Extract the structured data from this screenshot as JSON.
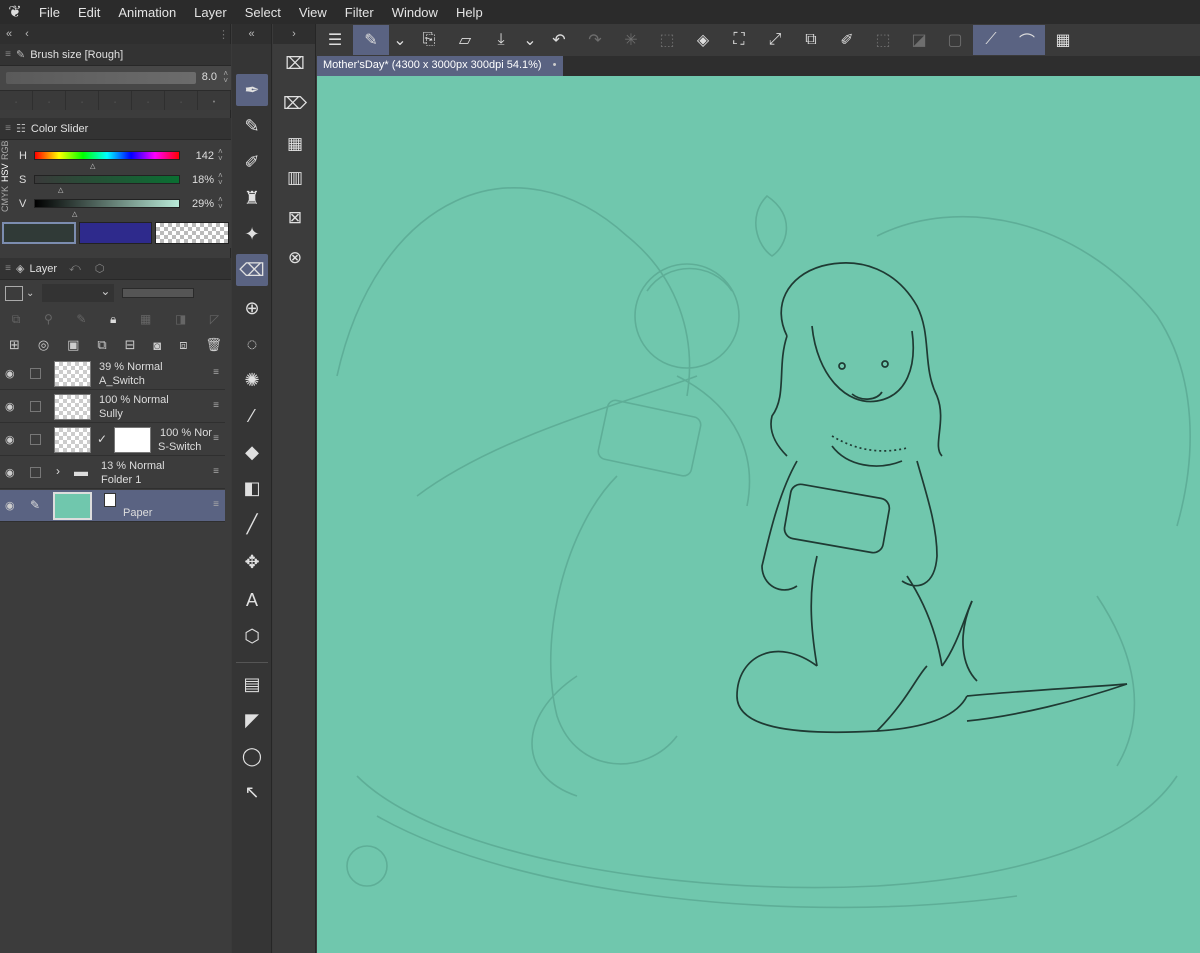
{
  "menu": [
    "File",
    "Edit",
    "Animation",
    "Layer",
    "Select",
    "View",
    "Filter",
    "Window",
    "Help"
  ],
  "brush": {
    "title": "Brush size [Rough]",
    "value": "8.0"
  },
  "color_slider": {
    "title": "Color Slider",
    "modes": [
      "RGB",
      "HSV",
      "CMYK"
    ],
    "rows": [
      {
        "label": "H",
        "value": "142"
      },
      {
        "label": "S",
        "value": "18%"
      },
      {
        "label": "V",
        "value": "29%"
      }
    ],
    "main_color": "#303a37",
    "sub_color": "#2e2a8c"
  },
  "layer_panel": {
    "title": "Layer",
    "layers": [
      {
        "mode": "39 % Normal",
        "name": "A_Switch"
      },
      {
        "mode": "100 % Normal",
        "name": "Sully"
      },
      {
        "mode": "100 % Nor",
        "name": "S-Switch"
      },
      {
        "mode": "13 % Normal",
        "name": "Folder 1"
      },
      {
        "mode": "",
        "name": "Paper"
      }
    ]
  },
  "document": {
    "tab_title": "Mother'sDay* (4300 x 3000px 300dpi 54.1%)"
  },
  "canvas": {
    "color": "#70c7ad"
  }
}
